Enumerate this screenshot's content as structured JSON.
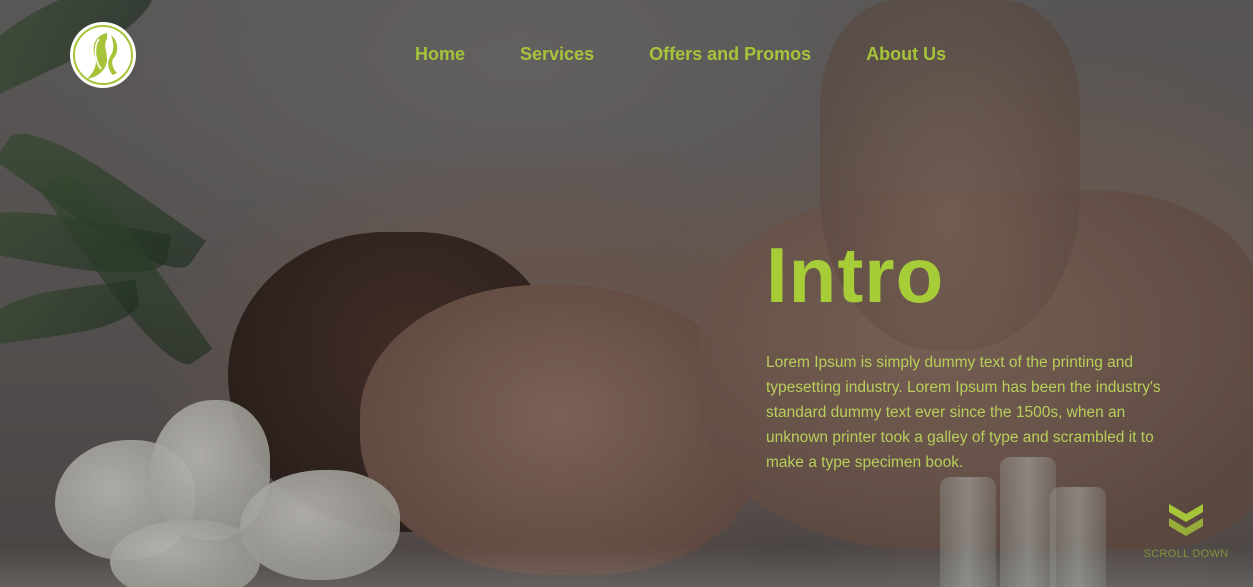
{
  "nav": {
    "items": [
      {
        "label": "Home"
      },
      {
        "label": "Services"
      },
      {
        "label": "Offers and Promos"
      },
      {
        "label": "About Us"
      }
    ]
  },
  "hero": {
    "title": "Intro",
    "body": "Lorem Ipsum is simply dummy text of the printing and typesetting industry. Lorem Ipsum has been the industry's standard dummy text ever since the 1500s, when an unknown printer took a galley of type and scrambled it to make a type specimen book.",
    "background_image": "woman-receiving-massage-photo",
    "scroll_label": "SCROLL DOWN",
    "scroll_icon": "double-chevron-down-icon"
  },
  "brand": {
    "logo_icon": "woman-silhouette-logo-icon"
  },
  "colors": {
    "accent": "#a6c43a",
    "title": "#a6cc38",
    "body_text": "#b7cf5a",
    "logo_bg": "#ffffff"
  }
}
